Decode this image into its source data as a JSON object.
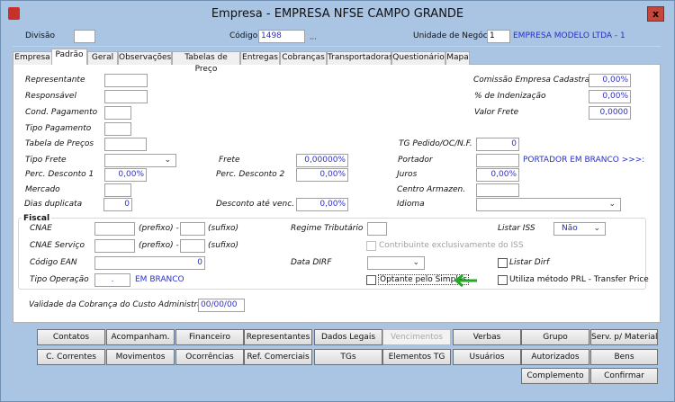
{
  "window": {
    "title": "Empresa - EMPRESA NFSE CAMPO GRANDE",
    "close_label": "x"
  },
  "header": {
    "divisao_label": "Divisão",
    "divisao_value": "",
    "codigo_label": "Código",
    "codigo_value": "1498",
    "codigo_lookup": "...",
    "unidade_label": "Unidade de Negócio",
    "unidade_value": "1",
    "unidade_desc": "EMPRESA MODELO LTDA - 1"
  },
  "tabs": [
    {
      "label": "Empresa"
    },
    {
      "label": "Padrão",
      "active": true
    },
    {
      "label": "Geral"
    },
    {
      "label": "Observações"
    },
    {
      "label": "Tabelas de Preço"
    },
    {
      "label": "Entregas"
    },
    {
      "label": "Cobranças"
    },
    {
      "label": "Transportadoras"
    },
    {
      "label": "Questionário"
    },
    {
      "label": "Mapa"
    }
  ],
  "form": {
    "representante": {
      "label": "Representante",
      "value": ""
    },
    "responsavel": {
      "label": "Responsável",
      "value": ""
    },
    "cond_pagamento": {
      "label": "Cond. Pagamento",
      "value": ""
    },
    "tipo_pagamento": {
      "label": "Tipo Pagamento",
      "value": ""
    },
    "tabela_precos": {
      "label": "Tabela de  Preços",
      "value": ""
    },
    "tipo_frete": {
      "label": "Tipo Frete",
      "value": ""
    },
    "perc_desconto1": {
      "label": "Perc. Desconto 1",
      "value": "0,00%"
    },
    "mercado": {
      "label": "Mercado",
      "value": ""
    },
    "dias_duplicata": {
      "label": "Dias duplicata",
      "value": "0"
    },
    "frete": {
      "label": "Frete",
      "value": "0,00000%"
    },
    "perc_desconto2": {
      "label": "Perc. Desconto 2",
      "value": "0,00%"
    },
    "desconto_venc": {
      "label": "Desconto até venc.",
      "value": "0,00%"
    },
    "comissao": {
      "label": "Comissão Empresa Cadastrada",
      "value": "0,00%"
    },
    "indenizacao": {
      "label": "% de Indenização",
      "value": "0,00%"
    },
    "valor_frete": {
      "label": "Valor Frete",
      "value": "0,0000"
    },
    "tg_pedido": {
      "label": "TG Pedido/OC/N.F.",
      "value": "0"
    },
    "portador": {
      "label": "Portador",
      "value": "",
      "desc": "PORTADOR EM BRANCO >>>:"
    },
    "juros": {
      "label": "Juros",
      "value": "0,00%"
    },
    "centro_armazen": {
      "label": "Centro Armazen.",
      "value": ""
    },
    "idioma": {
      "label": "Idioma",
      "value": ""
    }
  },
  "fiscal": {
    "title": "Fiscal",
    "cnae": {
      "label": "CNAE",
      "prefixo": "",
      "sufixo": "",
      "prefixo_label": "(prefixo) -",
      "sufixo_label": "(sufixo)"
    },
    "cnae_servico": {
      "label": "CNAE Serviço",
      "prefixo": "",
      "sufixo": "",
      "prefixo_label": "(prefixo) -",
      "sufixo_label": "(sufixo)"
    },
    "codigo_ean": {
      "label": "Código EAN",
      "value": "0"
    },
    "tipo_operacao": {
      "label": "Tipo Operação",
      "value": ".",
      "desc": "EM BRANCO"
    },
    "regime_tributario": {
      "label": "Regime Tributário",
      "value": ""
    },
    "contribuinte_iss": {
      "label": "Contribuinte exclusivamente do ISS",
      "checked": false,
      "disabled": true
    },
    "data_dirf": {
      "label": "Data DIRF",
      "value": ""
    },
    "optante_simples": {
      "label": "Optante pelo Simples",
      "checked": false
    },
    "listar_iss": {
      "label": "Listar  ISS",
      "value": "Não"
    },
    "listar_dirf": {
      "label": "Listar Dirf",
      "checked": false
    },
    "prl": {
      "label": "Utiliza método PRL - Transfer Price",
      "checked": false
    },
    "arrow_color": "#22aa22"
  },
  "validade": {
    "label": "Validade da Cobrança do Custo Administrativo",
    "value": "00/00/00"
  },
  "buttons": {
    "row1": [
      "Contatos",
      "Acompanham.",
      "Financeiro",
      "Representantes",
      "Dados Legais",
      "Vencimentos",
      "Verbas",
      "Grupo",
      "Serv. p/ Material"
    ],
    "row2": [
      "C. Correntes",
      "Movimentos",
      "Ocorrências",
      "Ref. Comerciais",
      "TGs",
      "Elementos TG",
      "Usuários",
      "Autorizados",
      "Bens"
    ],
    "complemento": "Complemento",
    "confirmar": "Confirmar",
    "disabled": [
      "Vencimentos"
    ]
  }
}
